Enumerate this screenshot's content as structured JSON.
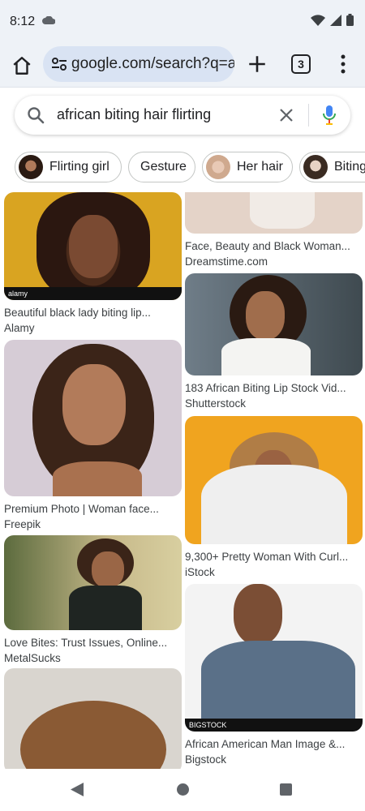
{
  "status_bar": {
    "time": "8:12"
  },
  "browser": {
    "url": "google.com/search?q=african+biting+hair+flirting",
    "tab_count": "3"
  },
  "search": {
    "query": "african biting hair flirting"
  },
  "chips": [
    {
      "label": "Flirting girl"
    },
    {
      "label": "Gesture"
    },
    {
      "label": "Her hair"
    },
    {
      "label": "Biting"
    }
  ],
  "results": [
    {
      "title": "Beautiful black lady biting lip...",
      "source": "Alamy",
      "watermark": "alamy"
    },
    {
      "title": "Premium Photo | Woman face...",
      "source": "Freepik"
    },
    {
      "title": "Love Bites: Trust Issues, Online...",
      "source": "MetalSucks"
    },
    {
      "title": "Face, Beauty and Black Woman...",
      "source": "Dreamstime.com"
    },
    {
      "title": "183 African Biting Lip Stock Vid...",
      "source": "Shutterstock"
    },
    {
      "title": "9,300+ Pretty Woman With Curl...",
      "source": "iStock"
    },
    {
      "title": "African American Man Image &...",
      "source": "Bigstock",
      "watermark": "BIGSTOCK"
    }
  ],
  "colors": {
    "chrome_bg": "#eef2f7",
    "url_pill": "#d9e3f3",
    "mic_blue": "#4285f4",
    "mic_red": "#ea4335"
  }
}
